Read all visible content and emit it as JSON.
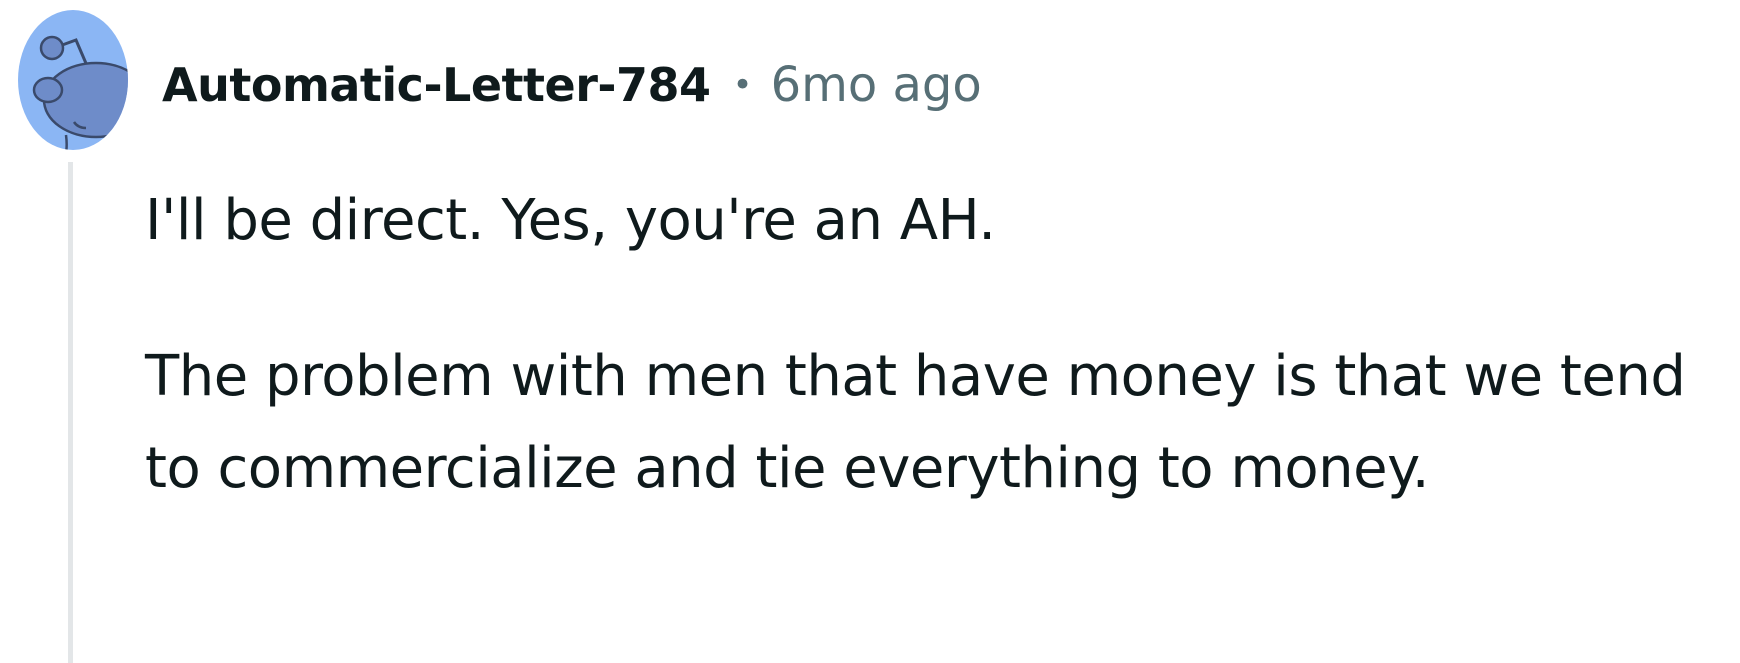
{
  "comment": {
    "author": "Automatic-Letter-784",
    "separator": "•",
    "timestamp": "6mo ago",
    "avatar_icon": "snoo-avatar-icon",
    "paragraphs": [
      "I'll be direct. Yes, you're an AH.",
      "The problem with men that have money is that we tend to commercialize and tie everything to money."
    ]
  },
  "colors": {
    "avatar_bg": "#8bb6f4",
    "avatar_figure": "#6e8cc9",
    "text_primary": "#0f1a1c",
    "text_secondary": "#576f76",
    "thread_line": "#e3e6e8"
  }
}
